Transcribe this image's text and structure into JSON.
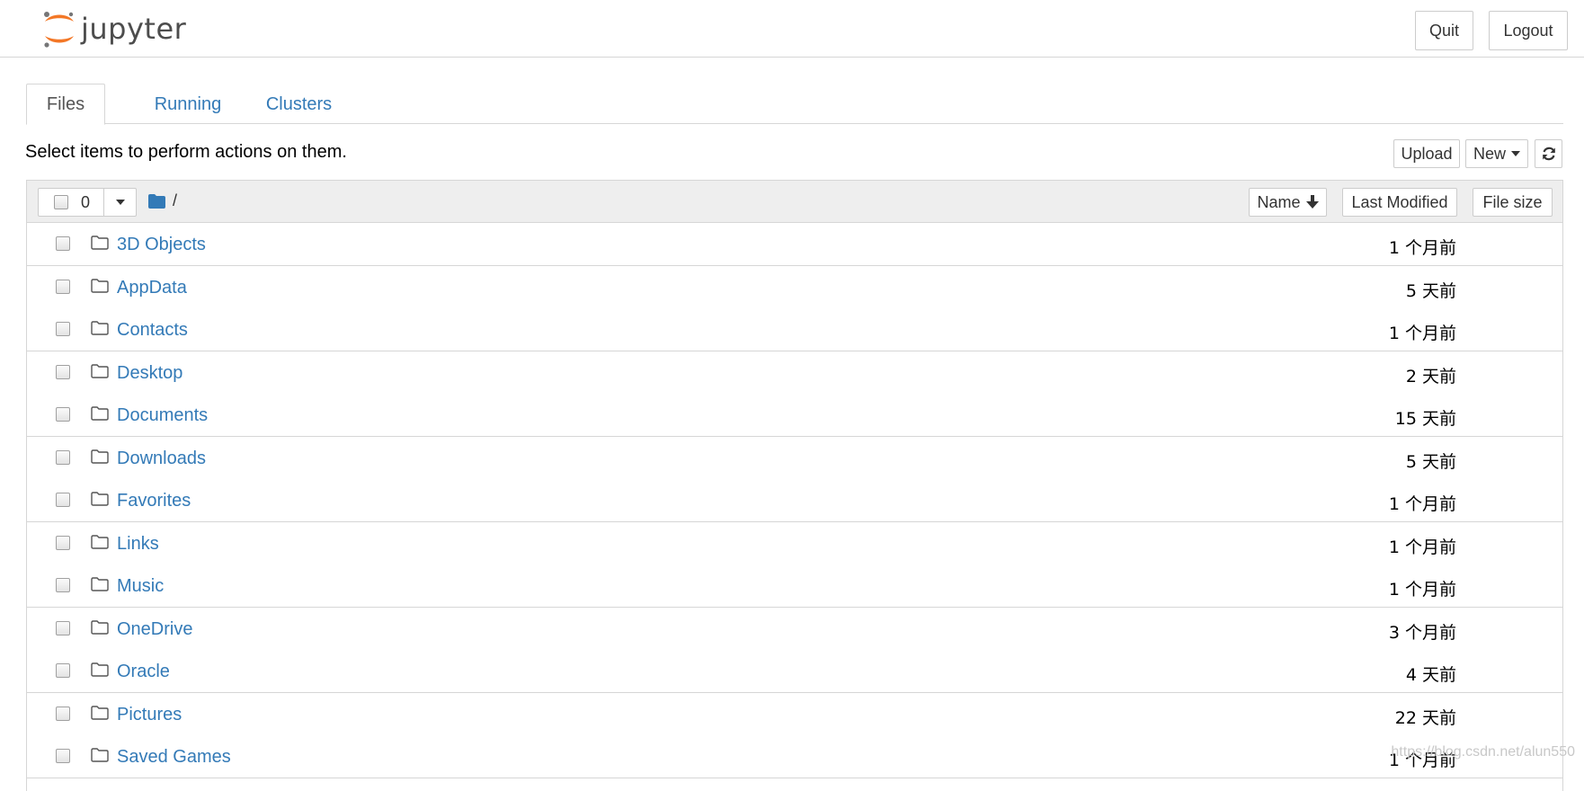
{
  "header": {
    "logo_text": "jupyter",
    "quit_label": "Quit",
    "logout_label": "Logout"
  },
  "tabs": [
    {
      "label": "Files",
      "active": true
    },
    {
      "label": "Running",
      "active": false
    },
    {
      "label": "Clusters",
      "active": false
    }
  ],
  "toolbar": {
    "instructions": "Select items to perform actions on them.",
    "upload_label": "Upload",
    "new_label": "New"
  },
  "list_header": {
    "selected_count": "0",
    "path": "/",
    "sort_name_label": "Name",
    "sort_modified_label": "Last Modified",
    "sort_size_label": "File size"
  },
  "files": [
    {
      "name": "3D Objects",
      "modified": "1 个月前"
    },
    {
      "name": "AppData",
      "modified": "5 天前"
    },
    {
      "name": "Contacts",
      "modified": "1 个月前"
    },
    {
      "name": "Desktop",
      "modified": "2 天前"
    },
    {
      "name": "Documents",
      "modified": "15 天前"
    },
    {
      "name": "Downloads",
      "modified": "5 天前"
    },
    {
      "name": "Favorites",
      "modified": "1 个月前"
    },
    {
      "name": "Links",
      "modified": "1 个月前"
    },
    {
      "name": "Music",
      "modified": "1 个月前"
    },
    {
      "name": "OneDrive",
      "modified": "3 个月前"
    },
    {
      "name": "Oracle",
      "modified": "4 天前"
    },
    {
      "name": "Pictures",
      "modified": "22 天前"
    },
    {
      "name": "Saved Games",
      "modified": "1 个月前"
    }
  ],
  "watermark": "https://blog.csdn.net/alun550",
  "colors": {
    "link": "#337ab7",
    "logo_orange": "#f37726",
    "border": "#d6d6d6",
    "header_bg": "#eeeeee"
  },
  "icons": {
    "folder": "folder-icon",
    "folder_solid": "folder-solid-icon",
    "refresh": "refresh-icon",
    "arrow_down": "arrow-down-icon",
    "caret": "caret-down-icon"
  }
}
